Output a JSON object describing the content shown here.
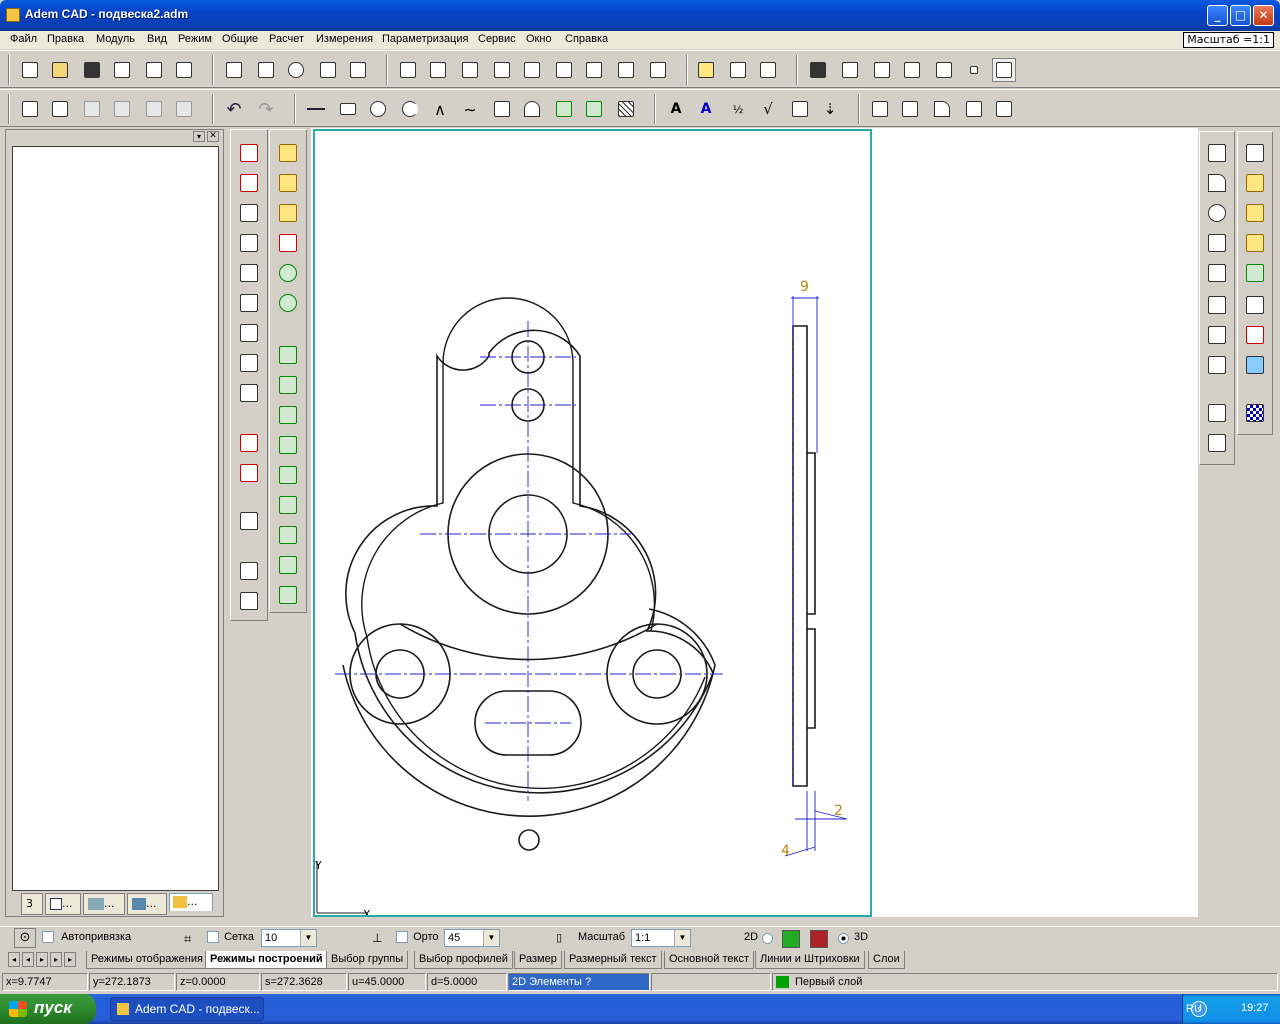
{
  "window": {
    "title": "Adem CAD - подвеска2.adm",
    "min": "_",
    "max": "□",
    "close": "✕"
  },
  "menu": [
    "Файл",
    "Правка",
    "Модуль",
    "Вид",
    "Режим",
    "Общие",
    "Расчет",
    "Измерения",
    "Параметризация",
    "Сервис",
    "Окно",
    "Справка"
  ],
  "scale_indicator": "Масштаб =1:1",
  "panel_tabs": [
    "3",
    "...",
    "...",
    "..."
  ],
  "drawing": {
    "dim_top": "9",
    "dim_right": "2",
    "dim_bottom": "4",
    "axis_y": "Y",
    "axis_x": "X"
  },
  "bottom_controls": {
    "autosnap": "Автопривязка",
    "grid": "Сетка",
    "grid_value": "10",
    "ortho": "Орто",
    "ortho_value": "45",
    "scale": "Масштаб",
    "scale_value": "1:1",
    "mode_2d": "2D",
    "mode_3d": "3D"
  },
  "tabs": [
    "Режимы отображения",
    "Режимы построений",
    "Выбор группы",
    "Выбор профилей",
    "Размер",
    "Размерный текст",
    "Основной текст",
    "Линии и Штриховки",
    "Слои"
  ],
  "status": {
    "x": "x=9.7747",
    "y": "y=272.1873",
    "z": "z=0.0000",
    "s": "s=272.3628",
    "u": "u=45.0000",
    "d": "d=5.0000",
    "hint": "2D Элементы ?",
    "layer": "Первый слой",
    "layer_color": "#00a000"
  },
  "taskbar": {
    "start": "пуск",
    "item": "Adem CAD - подвеск...",
    "lang": "RU",
    "clock": "19:27"
  }
}
